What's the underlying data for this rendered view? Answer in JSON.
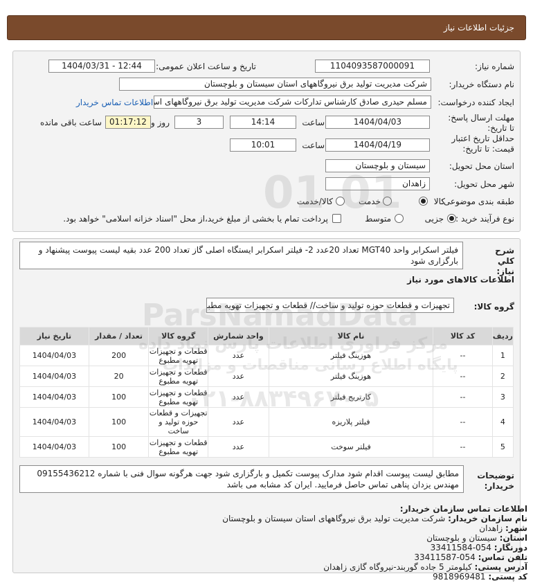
{
  "header": {
    "title": "جزئیات اطلاعات نیاز"
  },
  "fields": {
    "need_number_label": "شماره نیاز:",
    "need_number": "1104093587000091",
    "announce_label": "تاریخ و ساعت اعلان عمومی:",
    "announce_value": "1404/03/31 - 12:44",
    "buyer_org_label": "نام دستگاه خریدار:",
    "buyer_org": "شرکت مدیریت تولید برق نیروگاههای استان سیستان و بلوچستان",
    "creator_label": "ایجاد کننده درخواست:",
    "creator": "مسلم حیدری صادق کارشناس تدارکات شرکت مدیریت تولید برق نیروگاههای اس",
    "contact_link": "اطلاعات تماس خریدار",
    "deadline_label": "مهلت ارسال پاسخ: تا تاریخ:",
    "deadline_date": "1404/04/03",
    "time_label": "ساعت",
    "deadline_time": "14:14",
    "days_value": "3",
    "days_label": "روز و",
    "remaining_time": "01:17:12",
    "remaining_label": "ساعت باقی مانده",
    "validity_label": "حداقل تاریخ اعتبار قیمت: تا تاریخ:",
    "validity_date": "1404/04/19",
    "validity_time": "10:01",
    "province_label": "استان محل تحویل:",
    "province": "سیستان و بلوچستان",
    "city_label": "شهر محل تحویل:",
    "city": "زاهدان",
    "category_label": "طبقه بندی موضوعی:",
    "cat_goods": "کالا",
    "cat_service": "خدمت",
    "cat_goods_service": "کالا/خدمت",
    "process_label": "نوع فرآیند خرید :",
    "proc_partial": "جزیی",
    "proc_medium": "متوسط",
    "payment_text": "پرداخت تمام یا بخشی از مبلغ خرید،از محل \"اسناد خزانه اسلامی\" خواهد بود."
  },
  "summary": {
    "label": "شرح کلي نیاز:",
    "text": "فیلتر اسکرابر واحد MGT40 تعداد 20عدد 2- فیلتر اسکرابر ایستگاه اصلی گاز تعداد 200 عدد بقیه لیست پیوست پیشنهاد و بارگزاری شود"
  },
  "goods_info_title": "اطلاعات کالاهای مورد نیاز",
  "goods_group": {
    "label": "گروه کالا:",
    "value": "تجهیزات و قطعات حوزه تولید و ساخت// قطعات و تجهیزات تهویه مطبوع"
  },
  "table": {
    "headers": [
      "ردیف",
      "کد کالا",
      "نام کالا",
      "واحد شمارش",
      "گروه کالا",
      "تعداد / مقدار",
      "تاریخ نیاز"
    ],
    "rows": [
      [
        "1",
        "--",
        "هوزینگ فیلتر",
        "عدد",
        "قطعات و تجهیزات تهویه مطبوع",
        "200",
        "1404/04/03"
      ],
      [
        "2",
        "--",
        "هوزینگ فیلتر",
        "عدد",
        "قطعات و تجهیزات تهویه مطبوع",
        "20",
        "1404/04/03"
      ],
      [
        "3",
        "--",
        "کارتریج فیلتر",
        "عدد",
        "قطعات و تجهیزات تهویه مطبوع",
        "100",
        "1404/04/03"
      ],
      [
        "4",
        "--",
        "فیلتر پلاریزه",
        "عدد",
        "تجهیزات و قطعات حوزه تولید و ساخت",
        "100",
        "1404/04/03"
      ],
      [
        "5",
        "--",
        "فیلتر سوخت",
        "عدد",
        "قطعات و تجهیزات تهویه مطبوع",
        "100",
        "1404/04/03"
      ]
    ]
  },
  "notes": {
    "label": "توضیحات خریدار:",
    "text": "مطابق لیست پیوست اقدام شود مدارک پیوست تکمیل و بارگزاری شود جهت هرگونه سوال فنی با شماره 09155436212 مهندس یزدان پناهی تماس حاصل فرمایید. ایران کد مشابه می باشد"
  },
  "contact": {
    "title": "اطلاعات تماس سازمان خریدار:",
    "org_label": "نام سازمان خریدار:",
    "org": "شرکت مدیریت تولید برق نیروگاههای استان سیستان و بلوچستان",
    "city_label": "شهر:",
    "city": "زاهدان",
    "province_label": "استان:",
    "province": "سیستان و بلوچستان",
    "fax_label": "دورنگار:",
    "fax": "054-33411584",
    "phone_label": "تلفن تماس:",
    "phone": "054-33411587",
    "address_label": "آدرس پستی:",
    "address": "کیلومتر 5 جاده گوربند-نیروگاه گازی زاهدان",
    "postal_label": "کد پستی:",
    "postal": "9818969481"
  },
  "watermark": {
    "numbers": "01 01",
    "brand": "ParsNamadData",
    "line1": "مرکز فراوری اطلاعات پارس نماد داده",
    "line2": "پایگاه اطلاع رسانی مناقصات و مزایدات",
    "phone": "۰۲۱-۸۸۳۴۹۶۷۰-۵"
  }
}
